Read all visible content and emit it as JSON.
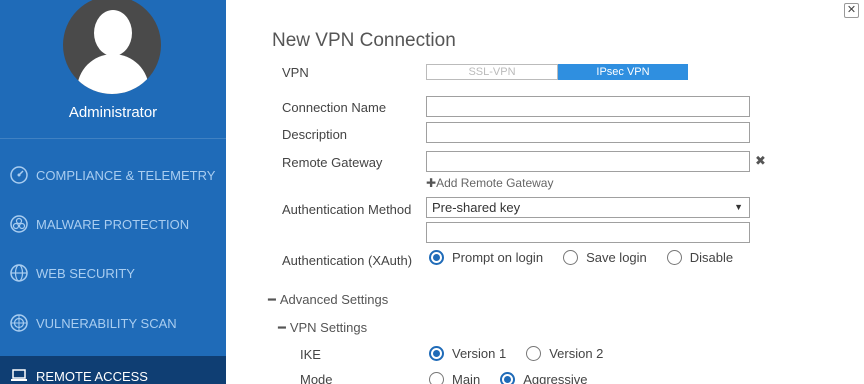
{
  "sidebar": {
    "user_name": "Administrator",
    "items": [
      {
        "label": "COMPLIANCE & TELEMETRY",
        "icon": "gauge-icon"
      },
      {
        "label": "MALWARE PROTECTION",
        "icon": "biohazard-icon"
      },
      {
        "label": "WEB SECURITY",
        "icon": "globe-icon"
      },
      {
        "label": "VULNERABILITY SCAN",
        "icon": "radar-icon"
      },
      {
        "label": "REMOTE ACCESS",
        "icon": "laptop-icon",
        "active": true
      }
    ]
  },
  "window": {
    "close_icon": "close-icon"
  },
  "form": {
    "title": "New VPN Connection",
    "vpn_label": "VPN",
    "vpn_options": [
      "SSL-VPN",
      "IPsec VPN"
    ],
    "vpn_selected": "IPsec VPN",
    "connection_name_label": "Connection Name",
    "connection_name_value": "",
    "description_label": "Description",
    "description_value": "",
    "remote_gateway_label": "Remote Gateway",
    "remote_gateway_value": "",
    "add_remote_gateway": "Add Remote Gateway",
    "auth_method_label": "Authentication Method",
    "auth_method_value": "Pre-shared key",
    "preshared_key_value": "",
    "xauth_label": "Authentication (XAuth)",
    "xauth_options": [
      "Prompt on login",
      "Save login",
      "Disable"
    ],
    "xauth_selected": "Prompt on login",
    "advanced_settings": "Advanced Settings",
    "vpn_settings": "VPN Settings",
    "ike_label": "IKE",
    "ike_options": [
      "Version 1",
      "Version 2"
    ],
    "ike_selected": "Version 1",
    "mode_label": "Mode",
    "mode_options": [
      "Main",
      "Aggressive"
    ],
    "mode_selected": "Aggressive"
  },
  "colors": {
    "sidebar_bg": "#1f6bb8",
    "sidebar_active": "#0f3e73",
    "accent": "#2f8fe0"
  }
}
